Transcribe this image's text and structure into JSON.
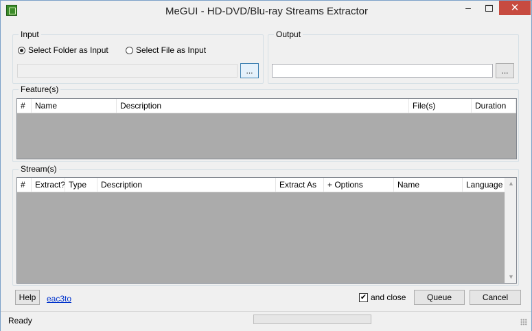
{
  "window": {
    "title": "MeGUI - HD-DVD/Blu-ray Streams Extractor",
    "controls": {
      "minimize": "–",
      "close": "✕"
    }
  },
  "input": {
    "legend": "Input",
    "radio_folder": "Select Folder as Input",
    "radio_file": "Select File as Input",
    "selected": "folder",
    "path_value": "",
    "browse_label": "..."
  },
  "output": {
    "legend": "Output",
    "path_value": "",
    "browse_label": "..."
  },
  "features": {
    "legend": "Feature(s)",
    "columns": [
      "#",
      "Name",
      "Description",
      "File(s)",
      "Duration"
    ],
    "rows": []
  },
  "streams": {
    "legend": "Stream(s)",
    "columns": [
      "#",
      "Extract?",
      "Type",
      "Description",
      "Extract As",
      "+ Options",
      "Name",
      "Language"
    ],
    "rows": []
  },
  "footer": {
    "help_label": "Help",
    "link_label": "eac3to",
    "and_close_label": "and close",
    "and_close_checked": true,
    "queue_label": "Queue",
    "cancel_label": "Cancel"
  },
  "status": {
    "text": "Ready",
    "progress": 0
  },
  "colors": {
    "close_button": "#c74b40",
    "list_background": "#ababab",
    "link": "#0033cc"
  }
}
